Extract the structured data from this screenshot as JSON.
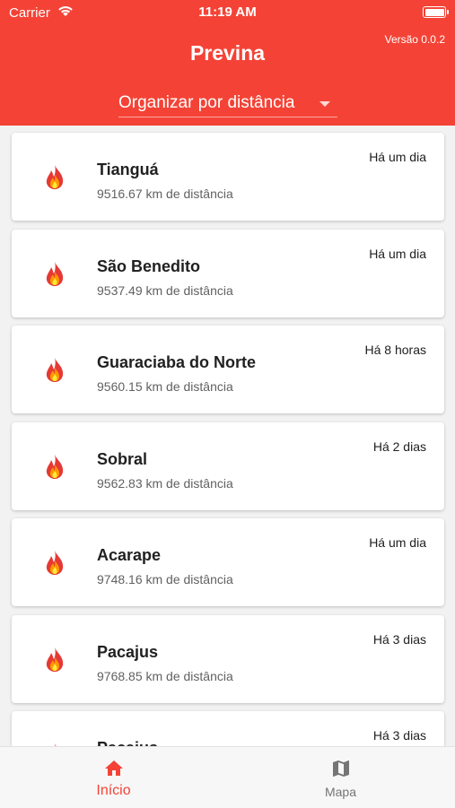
{
  "status_bar": {
    "carrier": "Carrier",
    "time": "11:19 AM"
  },
  "header": {
    "title": "Previna",
    "version": "Versão 0.0.2",
    "sort_label": "Organizar por distância",
    "accent_color": "#f44336"
  },
  "items": [
    {
      "city": "Tianguá",
      "distance": "9516.67 km de distância",
      "time_ago": "Há um dia",
      "icon": "fire-icon"
    },
    {
      "city": "São Benedito",
      "distance": "9537.49 km de distância",
      "time_ago": "Há um dia",
      "icon": "fire-icon"
    },
    {
      "city": "Guaraciaba do Norte",
      "distance": "9560.15 km de distância",
      "time_ago": "Há 8 horas",
      "icon": "fire-icon"
    },
    {
      "city": "Sobral",
      "distance": "9562.83 km de distância",
      "time_ago": "Há 2 dias",
      "icon": "fire-icon"
    },
    {
      "city": "Acarape",
      "distance": "9748.16 km de distância",
      "time_ago": "Há um dia",
      "icon": "fire-icon"
    },
    {
      "city": "Pacajus",
      "distance": "9768.85 km de distância",
      "time_ago": "Há 3 dias",
      "icon": "fire-icon"
    },
    {
      "city": "Pacajus",
      "distance": "",
      "time_ago": "Há 3 dias",
      "icon": "fire-icon"
    }
  ],
  "tabs": [
    {
      "label": "Início",
      "icon": "home-icon",
      "active": true
    },
    {
      "label": "Mapa",
      "icon": "map-icon",
      "active": false
    }
  ]
}
